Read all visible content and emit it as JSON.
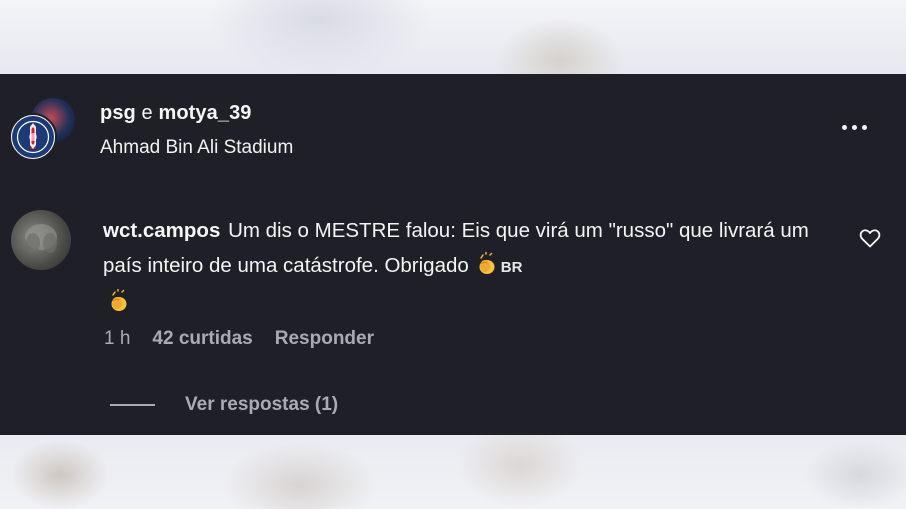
{
  "post_header": {
    "author_primary": "psg",
    "separator": "e",
    "author_secondary": "motya_39",
    "location": "Ahmad Bin Ali Stadium",
    "avatar_primary_icon": "psg-crest-icon",
    "avatar_secondary_icon": "user-photo",
    "more_options_icon": "more-horizontal-icon"
  },
  "comment": {
    "username": "wct.campos",
    "text": "Um dis o MESTRE falou: Eis que virá um \"russo\" que livrará um país inteiro de uma catástrofe. Obrigado",
    "emoji_1": "clapping-hands-icon",
    "flag_badge": "BR",
    "emoji_2": "clapping-hands-icon",
    "like_icon": "heart-outline-icon",
    "time_ago": "1 h",
    "likes": "42 curtidas",
    "reply_label": "Responder"
  },
  "replies": {
    "label": "Ver respostas (1)"
  },
  "colors": {
    "panel_bg": "#1f2027",
    "text_primary": "#f5f5f5",
    "text_secondary": "#a9abb3",
    "psg_blue": "#1d3a78",
    "psg_red": "#d7192d"
  }
}
